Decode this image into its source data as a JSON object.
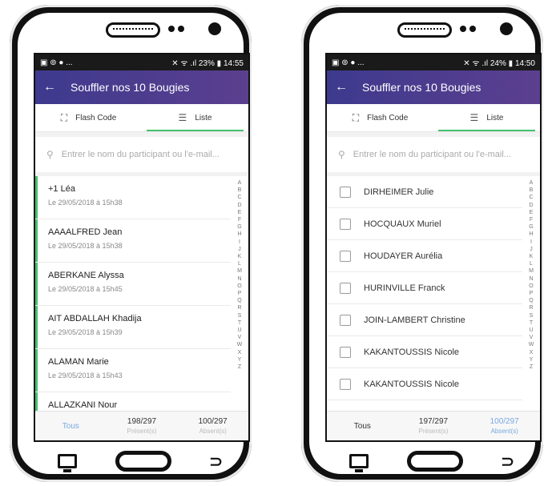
{
  "left": {
    "status": {
      "icons_left": "▣ ⊚ ● ...",
      "icons_right": "✕ ᯤ .ıl 23%",
      "battery_icon": "▮",
      "time": "14:55"
    },
    "appbar": {
      "back": "←",
      "title": "Souffler nos 10 Bougies"
    },
    "tabs": [
      {
        "icon": "⛶",
        "label": "Flash Code"
      },
      {
        "icon": "☰",
        "label": "Liste"
      }
    ],
    "search": {
      "placeholder": "Entrer le nom du participant ou l'e-mail..."
    },
    "items": [
      {
        "name": "+1 Léa",
        "date": "Le 29/05/2018 à 15h38"
      },
      {
        "name": "AAAALFRED Jean",
        "date": "Le 29/05/2018 à 15h38"
      },
      {
        "name": "ABERKANE Alyssa",
        "date": "Le 29/05/2018 à 15h45"
      },
      {
        "name": "AIT ABDALLAH Khadija",
        "date": "Le 29/05/2018 à 15h39"
      },
      {
        "name": "ALAMAN Marie",
        "date": "Le 29/05/2018 à 15h43"
      },
      {
        "name": "ALLAZKANI Nour",
        "date": ""
      }
    ],
    "bottom": [
      {
        "value": "Tous",
        "label": ""
      },
      {
        "value": "198/297",
        "label": "Présent(s)"
      },
      {
        "value": "100/297",
        "label": "Absent(s)"
      }
    ]
  },
  "right": {
    "status": {
      "icons_left": "▣ ⊚ ● ...",
      "icons_right": "✕ ᯤ .ıl 24%",
      "battery_icon": "▮",
      "time": "14:50"
    },
    "appbar": {
      "back": "←",
      "title": "Souffler nos 10 Bougies"
    },
    "tabs": [
      {
        "icon": "⛶",
        "label": "Flash Code"
      },
      {
        "icon": "☰",
        "label": "Liste"
      }
    ],
    "search": {
      "placeholder": "Entrer le nom du participant ou l'e-mail..."
    },
    "items": [
      {
        "name": "DIRHEIMER Julie"
      },
      {
        "name": "HOCQUAUX Muriel"
      },
      {
        "name": "HOUDAYER Aurélia"
      },
      {
        "name": "HURINVILLE Franck"
      },
      {
        "name": "JOIN-LAMBERT Christine"
      },
      {
        "name": "KAKANTOUSSIS Nicole"
      },
      {
        "name": "KAKANTOUSSIS Nicole"
      }
    ],
    "bottom": [
      {
        "value": "Tous",
        "label": ""
      },
      {
        "value": "197/297",
        "label": "Présent(s)"
      },
      {
        "value": "100/297",
        "label": "Absent(s)"
      }
    ]
  },
  "alphabet": [
    "A",
    "B",
    "C",
    "D",
    "E",
    "F",
    "G",
    "H",
    "I",
    "J",
    "K",
    "L",
    "M",
    "N",
    "O",
    "P",
    "Q",
    "R",
    "S",
    "T",
    "U",
    "V",
    "W",
    "X",
    "Y",
    "Z"
  ],
  "navbar": {
    "back_glyph": "⊃"
  },
  "colors": {
    "appbar": "#4a3c8f",
    "accent": "#45c06f",
    "active_filter": "#79a8e0"
  }
}
